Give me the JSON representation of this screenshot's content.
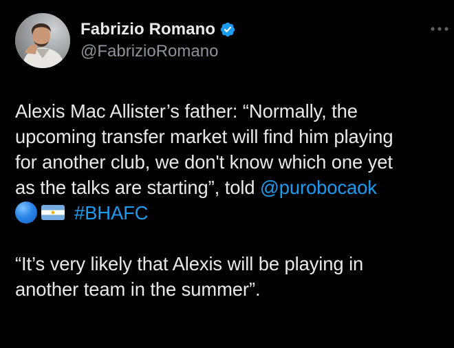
{
  "author": {
    "display_name": "Fabrizio Romano",
    "handle": "@FabrizioRomano",
    "verified_badge_color": "#1d9bf0",
    "avatar_icon": "profile-photo"
  },
  "more_icon": "more-horizontal-icon",
  "tweet": {
    "line1": "Alexis Mac Allister’s father: “Normally, the",
    "line2": "upcoming transfer market will find him playing",
    "line3": "for another club, we don't know which one yet",
    "line4_prefix": "as the talks are starting”, told ",
    "mention": "@purobocaok",
    "hashtag": "#BHAFC",
    "quote_line1": "“It’s very likely that Alexis will be playing in",
    "quote_line2": "another team in the summer”.",
    "emojis": [
      "blue-circle-emoji",
      "argentina-flag-emoji"
    ]
  },
  "colors": {
    "background": "#000000",
    "text": "#e7e9ea",
    "secondary_text": "#8b939b",
    "link": "#1d9bf0"
  }
}
